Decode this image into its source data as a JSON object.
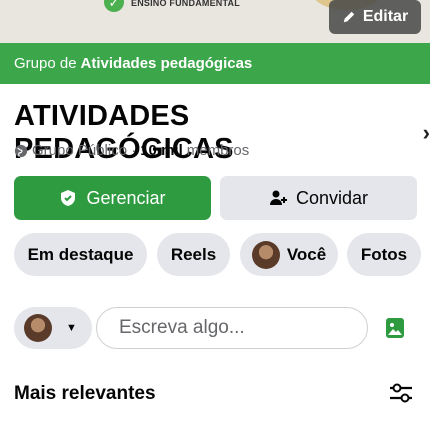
{
  "cover": {
    "caption": "ENSINO FUNDAMENTAL",
    "edit_label": "Editar"
  },
  "banner": {
    "prefix": "Grupo de",
    "group_name": "Atividades pedagógicas"
  },
  "group": {
    "title": "ATIVIDADES PEDAGÓGICAS",
    "privacy": "Grupo Público ·",
    "member_count": "10 mil",
    "members_label": "membros"
  },
  "actions": {
    "manage_label": "Gerenciar",
    "invite_label": "Convidar"
  },
  "tabs": [
    {
      "label": "Em destaque"
    },
    {
      "label": "Reels"
    },
    {
      "label": "Você"
    },
    {
      "label": "Fotos"
    }
  ],
  "composer": {
    "placeholder": "Escreva algo..."
  },
  "feed": {
    "section_title": "Mais relevantes"
  },
  "colors": {
    "brand_green": "#3ca64b",
    "button_green": "#2f9b40",
    "chip_gray": "#e4e6eb"
  }
}
